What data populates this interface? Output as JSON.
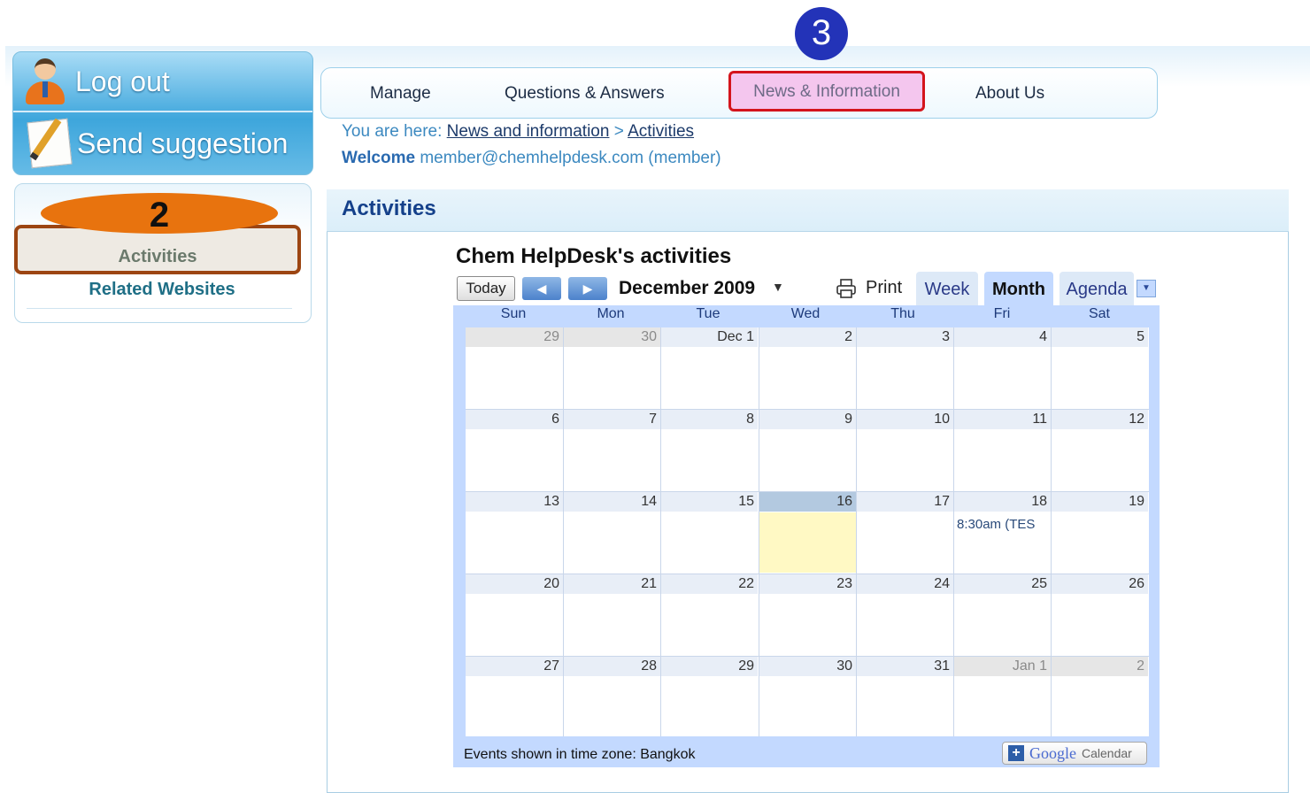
{
  "markers": {
    "step3": "3",
    "step2": "2"
  },
  "left_panel": {
    "logout_label": "Log out",
    "suggestion_label": "Send suggestion",
    "nav_items": [
      "Activities",
      "Related Websites"
    ]
  },
  "top_menu": {
    "items": [
      "Manage",
      "Questions & Answers",
      "News & Information",
      "About Us"
    ],
    "active": "News & Information"
  },
  "breadcrumb": {
    "prefix": "You are here:",
    "path": [
      "News and information",
      "Activities"
    ],
    "separator": ">"
  },
  "welcome": {
    "label": "Welcome",
    "user": "member@chemhelpdesk.com (member)"
  },
  "content": {
    "title": "Activities"
  },
  "calendar": {
    "title": "Chem HelpDesk's activities",
    "today_button": "Today",
    "month_label": "December 2009",
    "print_label": "Print",
    "view_tabs": [
      "Week",
      "Month",
      "Agenda"
    ],
    "active_view": "Month",
    "days_of_week": [
      "Sun",
      "Mon",
      "Tue",
      "Wed",
      "Thu",
      "Fri",
      "Sat"
    ],
    "weeks": [
      [
        "29",
        "30",
        "Dec 1",
        "2",
        "3",
        "4",
        "5"
      ],
      [
        "6",
        "7",
        "8",
        "9",
        "10",
        "11",
        "12"
      ],
      [
        "13",
        "14",
        "15",
        "16",
        "17",
        "18",
        "19"
      ],
      [
        "20",
        "21",
        "22",
        "23",
        "24",
        "25",
        "26"
      ],
      [
        "27",
        "28",
        "29",
        "30",
        "31",
        "Jan 1",
        "2"
      ]
    ],
    "today": "16",
    "event": {
      "day": "18",
      "text": "8:30am (TES"
    },
    "timezone_note": "Events shown in time zone: Bangkok",
    "google_badge": {
      "brand": "Google",
      "product": "Calendar"
    }
  },
  "colors": {
    "accent_blue": "#3ea6dc",
    "highlight_red": "#d4141c",
    "highlight_orange": "#e8730e",
    "marker_blue": "#2333b8",
    "calendar_blue": "#c3d9ff",
    "today_yellow": "#fff9c4"
  },
  "icons": [
    "user-icon",
    "pencil-note-icon",
    "left-arrow-icon",
    "right-arrow-icon",
    "dropdown-arrow-icon",
    "printer-icon",
    "google-plus-icon"
  ]
}
